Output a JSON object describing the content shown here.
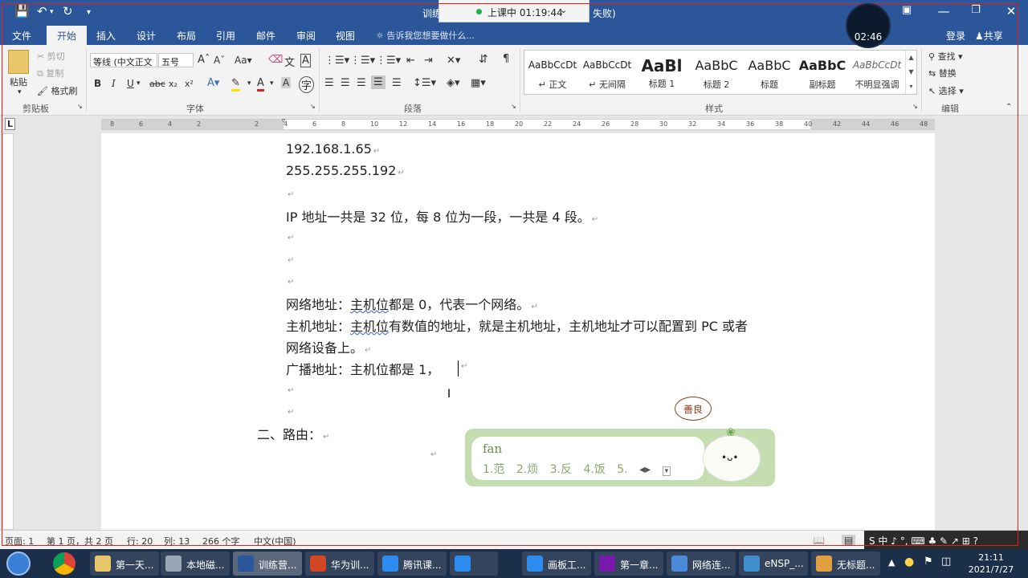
{
  "title_bar": {
    "doc_name_left": "训练",
    "doc_name_right": "失败)",
    "class_timer": "上课中 01:19:44",
    "record_time": "02:46"
  },
  "tabs": [
    "文件",
    "开始",
    "插入",
    "设计",
    "布局",
    "引用",
    "邮件",
    "审阅",
    "视图"
  ],
  "tell_me": "告诉我您想要做什么...",
  "account": {
    "login": "登录",
    "share": "共享"
  },
  "ribbon": {
    "clipboard": {
      "paste": "粘贴",
      "cut": "剪切",
      "copy": "复制",
      "format_painter": "格式刷",
      "label": "剪贴板"
    },
    "font": {
      "name": "等线 (中文正文",
      "size": "五号",
      "label": "字体"
    },
    "paragraph": {
      "label": "段落"
    },
    "styles": {
      "label": "样式",
      "items": [
        {
          "preview": "AaBbCcDt",
          "name": "↵ 正文"
        },
        {
          "preview": "AaBbCcDt",
          "name": "↵ 无间隔"
        },
        {
          "preview": "AaBl",
          "name": "标题 1"
        },
        {
          "preview": "AaBbC",
          "name": "标题 2"
        },
        {
          "preview": "AaBbC",
          "name": "标题"
        },
        {
          "preview": "AaBbC",
          "name": "副标题"
        },
        {
          "preview": "AaBbCcDt",
          "name": "不明显强调"
        }
      ]
    },
    "editing": {
      "find": "查找",
      "replace": "替换",
      "select": "选择",
      "label": "编辑"
    }
  },
  "ruler_ticks": [
    "8",
    "6",
    "4",
    "2",
    "2",
    "4",
    "6",
    "8",
    "10",
    "12",
    "14",
    "16",
    "18",
    "20",
    "22",
    "24",
    "26",
    "28",
    "30",
    "32",
    "34",
    "36",
    "38",
    "40",
    "42",
    "44",
    "46",
    "48"
  ],
  "document": {
    "lines": [
      "192.168.1.65",
      "255.255.255.192",
      "",
      "IP 地址一共是 32 位，每 8 位为一段，一共是 4 段。",
      "",
      "",
      "",
      "网络地址：",
      "主机位",
      "都是 0，代表一个网络。",
      "主机地址：",
      "主机位",
      "有数值的地址，就是主机地址，主机地址才可以配置到 PC 或者",
      "网络设备上。",
      "广播地址：主机位都是 1，",
      "",
      "",
      "二、路由：",
      ""
    ]
  },
  "ime": {
    "composition": "fan",
    "candidates": [
      "1.范",
      "2.烦",
      "3.反",
      "4.饭",
      "5."
    ],
    "mascot_text": "善良"
  },
  "status": {
    "page": "页面: 1",
    "page_of": "第 1 页，共 2 页",
    "row": "行: 20",
    "col": "列: 13",
    "words": "266 个字",
    "lang": "中文(中国)"
  },
  "ime_bar": "S 中 ♪ °, ⌨ ♣ ✎ ↗ ⊞ ?",
  "taskbar": {
    "items": [
      "第一天...",
      "本地磁...",
      "训练营...",
      "华为训...",
      "腾讯课...",
      "",
      "画板工...",
      "第一章...",
      "网络连...",
      "eNSP_...",
      "无标题..."
    ],
    "time": "21:11",
    "date": "2021/7/27"
  },
  "colors": {
    "word_blue": "#2b579a",
    "ribbon_bg": "#f3f3f3",
    "ime_green": "#c6dcb1",
    "frame_red": "#e02020"
  }
}
